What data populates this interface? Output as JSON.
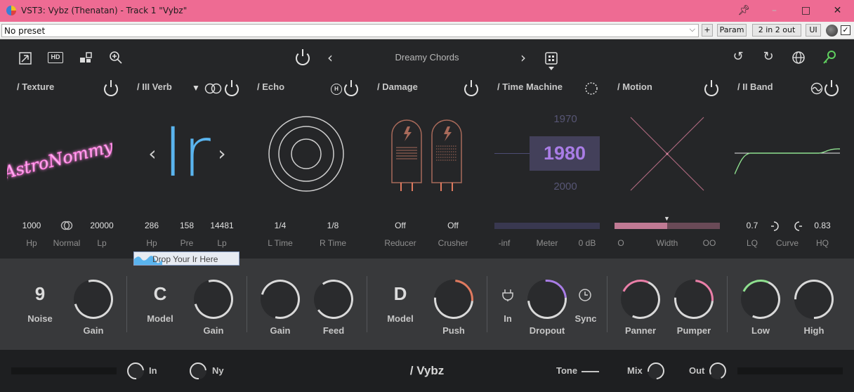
{
  "window": {
    "title": "VST3: Vybz (Thenatan) - Track 1 \"Vybz\""
  },
  "host": {
    "preset": "No preset",
    "plus": "+",
    "param": "Param",
    "routing": "2 in 2 out",
    "ui": "UI"
  },
  "topbar": {
    "preset_name": "Dreamy Chords"
  },
  "sections": [
    {
      "title": "/ Texture",
      "params": [
        {
          "value": "1000",
          "label": "Hp"
        },
        {
          "value": "",
          "label": "Normal"
        },
        {
          "value": "20000",
          "label": "Lp"
        }
      ]
    },
    {
      "title": "/ III Verb",
      "display": "Ir",
      "drop_text": "Drop Your Ir Here",
      "params": [
        {
          "value": "286",
          "label": "Hp"
        },
        {
          "value": "158",
          "label": "Pre"
        },
        {
          "value": "14481",
          "label": "Lp"
        }
      ]
    },
    {
      "title": "/ Echo",
      "params": [
        {
          "value": "1/4",
          "label": "L Time"
        },
        {
          "value": "1/8",
          "label": "R Time"
        }
      ]
    },
    {
      "title": "/ Damage",
      "params": [
        {
          "value": "Off",
          "label": "Reducer"
        },
        {
          "value": "Off",
          "label": "Crusher"
        }
      ]
    },
    {
      "title": "/ Time Machine",
      "years": [
        "1970",
        "1980",
        "2000"
      ],
      "params": [
        {
          "label": "-inf"
        },
        {
          "label": "Meter"
        },
        {
          "label": "0 dB"
        }
      ]
    },
    {
      "title": "/ Motion",
      "params": [
        {
          "label": "O"
        },
        {
          "label": "Width"
        },
        {
          "label": "OO"
        }
      ]
    },
    {
      "title": "/ II Band",
      "params": [
        {
          "value": "0.7",
          "label": "LQ"
        },
        {
          "value": "",
          "label": "Curve"
        },
        {
          "value": "0.83",
          "label": "HQ"
        }
      ]
    }
  ],
  "texture_logo": "AstroNommy",
  "lower": {
    "texture": {
      "big": "9",
      "big_label": "Noise",
      "knob": "Gain"
    },
    "verb": {
      "big": "C",
      "big_label": "Model",
      "knob": "Gain"
    },
    "echo": {
      "knob1": "Gain",
      "knob2": "Feed"
    },
    "damage": {
      "big": "D",
      "big_label": "Model",
      "knob": "Push"
    },
    "time": {
      "in": "In",
      "knob": "Dropout",
      "sync": "Sync"
    },
    "motion": {
      "knob1": "Panner",
      "knob2": "Pumper"
    },
    "band": {
      "knob1": "Low",
      "knob2": "High"
    }
  },
  "bottom": {
    "in": "In",
    "ny": "Ny",
    "brand": "/ Vybz",
    "tone": "Tone",
    "mix": "Mix",
    "out": "Out"
  },
  "colors": {
    "titlebar": "#ee6b93",
    "accent_blue": "#5ab4ee",
    "accent_purple": "#a97de6",
    "motion_pink": "#c07a94",
    "band_green": "#8fe08f",
    "tube_brown": "#a86a5a",
    "logo_pink": "#ff7ee5"
  }
}
